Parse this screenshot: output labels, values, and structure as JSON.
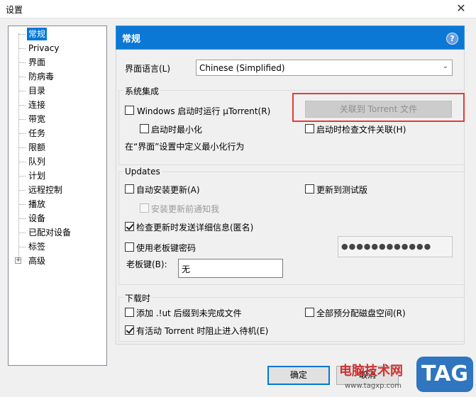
{
  "window": {
    "title": "设置",
    "close_glyph": "✕"
  },
  "tree": {
    "items": [
      "常规",
      "Privacy",
      "界面",
      "防病毒",
      "目录",
      "连接",
      "带宽",
      "任务",
      "限额",
      "队列",
      "计划",
      "远程控制",
      "播放",
      "设备",
      "已配对设备",
      "标签",
      "高级"
    ],
    "selected": "常规",
    "expander_glyph": "+"
  },
  "header": {
    "title": "常规",
    "help_glyph": "?"
  },
  "language": {
    "label": "界面语言(L)",
    "value": "Chinese (Simplified)",
    "arrow": "⌄"
  },
  "system": {
    "title": "系统集成",
    "start_with_windows": "Windows 启动时运行 µTorrent(R)",
    "start_minimized": "启动时最小化",
    "minimize_note": "在“界面”设置中定义最小化行为",
    "associate_button": "关联到 Torrent 文件",
    "check_assoc": "启动时检查文件关联(H)"
  },
  "updates": {
    "title": "Updates",
    "auto_install": "自动安装更新(A)",
    "beta": "更新到测试版",
    "notify_before": "安装更新前通知我",
    "send_details": "检查更新时发送详细信息(匿名)",
    "use_boss_key_pwd": "使用老板键密码",
    "password_mask": "●●●●●●●●●●●●",
    "boss_key_label": "老板键(B):",
    "boss_key_value": "无"
  },
  "download": {
    "title": "下载时",
    "add_lut": "添加 .!ut 后缀到未完成文件",
    "prealloc": "全部预分配磁盘空间(R)",
    "prevent_standby": "有活动 Torrent 时阻止进入待机(E)"
  },
  "buttons": {
    "ok": "确定",
    "cancel": "取消"
  },
  "watermark": {
    "site": "电脑技术网",
    "url": "www.tagxp.com",
    "tag": "TAG"
  },
  "colors": {
    "accent": "#0c78d6",
    "highlight": "#e53935",
    "selection": "#0078d7"
  }
}
